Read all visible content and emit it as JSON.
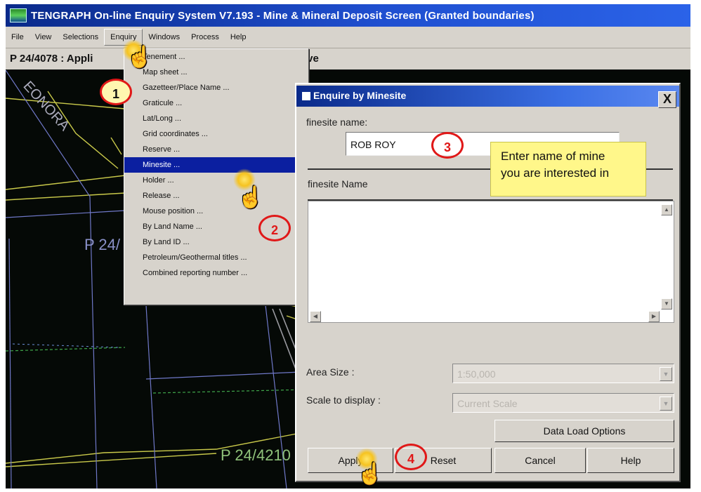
{
  "window": {
    "title": "TENGRAPH On-line Enquiry System V7.193 - Mine & Mineral Deposit Screen (Granted boundaries)"
  },
  "menubar": {
    "items": [
      "File",
      "View",
      "Selections",
      "Enquiry",
      "Windows",
      "Process",
      "Help"
    ]
  },
  "statusbar": {
    "left_text": "P 24/4078  :  Appli",
    "right_text": "ive"
  },
  "map": {
    "labels": [
      "EONORA",
      "P 24/",
      "P 24/4210"
    ]
  },
  "enquiry_menu": {
    "items": [
      "Tenement ...",
      "Map sheet ...",
      "Gazetteer/Place Name ...",
      "Graticule ...",
      "Lat/Long ...",
      "Grid coordinates ...",
      "Reserve ...",
      "Minesite ...",
      "Holder ...",
      "Release ...",
      "Mouse position ...",
      "By Land Name ...",
      "By Land ID ...",
      "Petroleum/Geothermal titles ...",
      "Combined reporting number ..."
    ],
    "selected": "Minesite ..."
  },
  "dialog": {
    "title": "Enquire by Minesite",
    "close": "X",
    "name_label": "finesite name:",
    "name_value": "ROB ROY",
    "list_header": "finesite Name",
    "area_size_label": "Area Size :",
    "area_size_value": "1:50,000",
    "scale_label": "Scale to display :",
    "scale_value": "Current Scale",
    "data_load_button": "Data Load Options",
    "apply_button": "Apply",
    "reset_button": "Reset",
    "cancel_button": "Cancel",
    "help_button": "Help"
  },
  "annotations": {
    "tooltip_line1": "Enter name of mine",
    "tooltip_line2": "you are interested in",
    "steps": [
      "1",
      "2",
      "3",
      "4"
    ]
  },
  "colors": {
    "title_bar": "#0a2a8a",
    "menu_selected": "#0b1fa0",
    "tooltip": "#fff78a",
    "step_ring": "#e01818",
    "map_background": "#050906"
  }
}
